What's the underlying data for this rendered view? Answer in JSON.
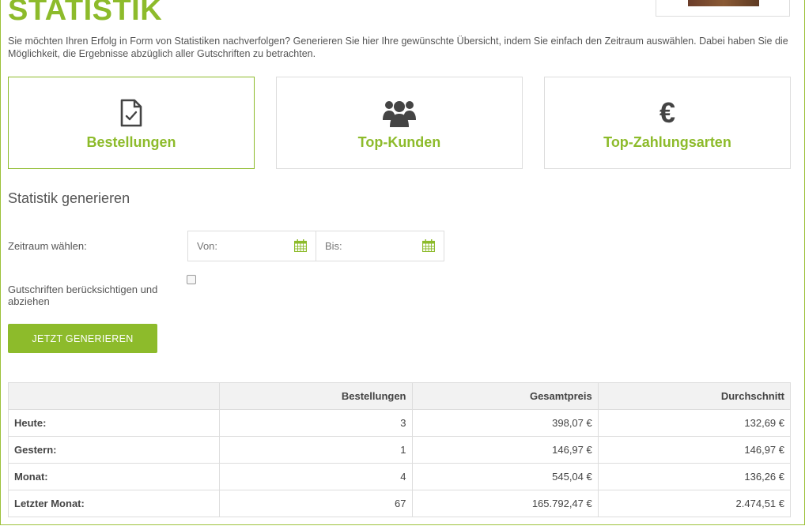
{
  "page": {
    "title": "STATISTIK",
    "intro": "Sie möchten Ihren Erfolg in Form von Statistiken nachverfolgen? Generieren Sie hier Ihre gewünschte Übersicht, indem Sie einfach den Zeitraum auswählen. Dabei haben Sie die Möglichkeit, die Ergebnisse abzüglich aller Gutschriften zu betrachten."
  },
  "cards": [
    {
      "label": "Bestellungen",
      "icon": "document-check-icon",
      "active": true
    },
    {
      "label": "Top-Kunden",
      "icon": "users-group-icon",
      "active": false
    },
    {
      "label": "Top-Zahlungsarten",
      "icon": "euro-icon",
      "symbol": "€",
      "active": false
    }
  ],
  "form": {
    "heading": "Statistik generieren",
    "period_label": "Zeitraum wählen:",
    "from_placeholder": "Von:",
    "to_placeholder": "Bis:",
    "credit_label": "Gutschriften berücksichtigen und abziehen",
    "credit_checked": false,
    "submit_label": "JETZT GENERIEREN"
  },
  "colors": {
    "accent": "#8dbb2b",
    "border": "#dddddd",
    "header_bg": "#f2f2f2"
  },
  "table": {
    "headers": [
      "",
      "Bestellungen",
      "Gesamtpreis",
      "Durchschnitt"
    ],
    "rows": [
      {
        "label": "Heute:",
        "orders": "3",
        "total": "398,07 €",
        "avg": "132,69 €"
      },
      {
        "label": "Gestern:",
        "orders": "1",
        "total": "146,97 €",
        "avg": "146,97 €"
      },
      {
        "label": "Monat:",
        "orders": "4",
        "total": "545,04 €",
        "avg": "136,26 €"
      },
      {
        "label": "Letzter Monat:",
        "orders": "67",
        "total": "165.792,47 €",
        "avg": "2.474,51 €"
      }
    ]
  }
}
